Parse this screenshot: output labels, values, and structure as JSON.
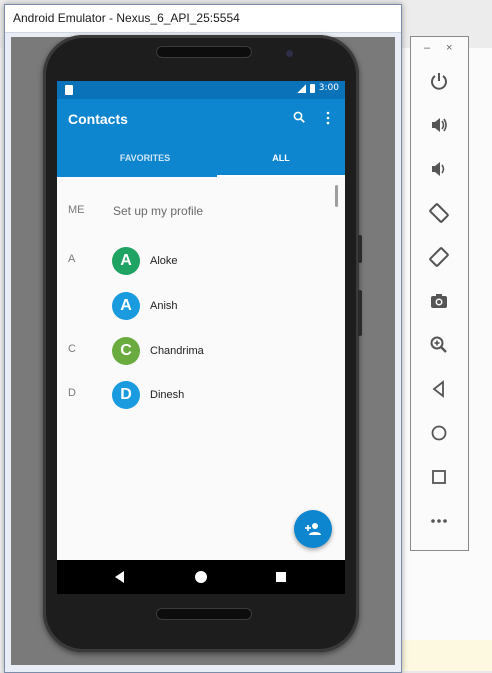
{
  "window": {
    "title": "Android Emulator - Nexus_6_API_25:5554"
  },
  "status_bar": {
    "time": "3:00"
  },
  "app_bar": {
    "title": "Contacts"
  },
  "tabs": [
    {
      "label": "FAVORITES",
      "active": false
    },
    {
      "label": "ALL",
      "active": true
    }
  ],
  "profile": {
    "section": "ME",
    "label": "Set up my profile"
  },
  "contacts": [
    {
      "section": "A",
      "initial": "A",
      "name": "Aloke",
      "color": "#1ea362"
    },
    {
      "section": "",
      "initial": "A",
      "name": "Anish",
      "color": "#1a9be0"
    },
    {
      "section": "C",
      "initial": "C",
      "name": "Chandrima",
      "color": "#6aab3f"
    },
    {
      "section": "D",
      "initial": "D",
      "name": "Dinesh",
      "color": "#1a9be0"
    }
  ],
  "toolbar": {
    "minimize": "–",
    "close": "×",
    "buttons": [
      "power-icon",
      "volume-up-icon",
      "volume-down-icon",
      "rotate-left-icon",
      "rotate-right-icon",
      "camera-icon",
      "zoom-icon",
      "back-icon",
      "home-icon",
      "overview-icon",
      "more-icon"
    ]
  },
  "colors": {
    "primary": "#0d85cf",
    "primary_dark": "#0a72b9"
  }
}
